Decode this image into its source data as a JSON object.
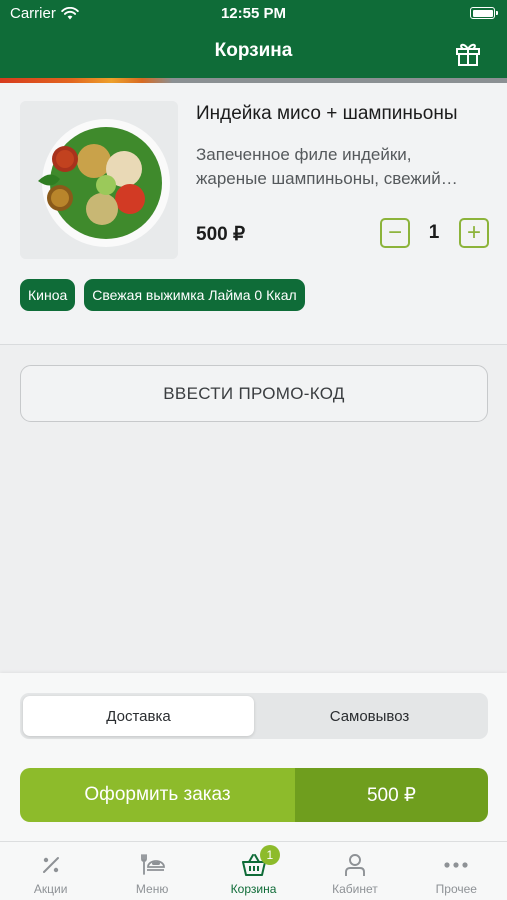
{
  "status_bar": {
    "carrier": "Carrier",
    "time": "12:55 PM"
  },
  "header": {
    "title": "Корзина",
    "gift_icon": "gift-icon",
    "stripe_colors": [
      "#d73b1e",
      "#e2651f",
      "#eda02b",
      "#8b9093"
    ]
  },
  "cart": {
    "items": [
      {
        "title": "Индейка мисо + шампиньоны",
        "description_line1": "Запеченное филе индейки,",
        "description_line2": "жареные шампиньоны, свежий…",
        "price": "500 ₽",
        "quantity": "1",
        "minus_label": "−",
        "plus_label": "+",
        "tags": [
          "Киноа",
          "Свежая выжимка Лайма 0 Ккал"
        ]
      }
    ]
  },
  "promo": {
    "label": "ВВЕСТИ ПРОМО-КОД"
  },
  "delivery": {
    "options": [
      "Доставка",
      "Самовывоз"
    ],
    "selected": "Доставка"
  },
  "checkout": {
    "label": "Оформить заказ",
    "total": "500 ₽"
  },
  "tabbar": {
    "tabs": [
      {
        "label": "Акции",
        "icon": "percent-icon"
      },
      {
        "label": "Меню",
        "icon": "dish-icon"
      },
      {
        "label": "Корзина",
        "icon": "basket-icon",
        "badge": "1",
        "active": true
      },
      {
        "label": "Кабинет",
        "icon": "user-icon"
      },
      {
        "label": "Прочее",
        "icon": "more-icon"
      }
    ]
  },
  "colors": {
    "brand_green": "#0f6c38",
    "accent_lime": "#8dbb2b",
    "accent_lime_dark": "#6f9e1e",
    "background": "#eeeff0"
  }
}
